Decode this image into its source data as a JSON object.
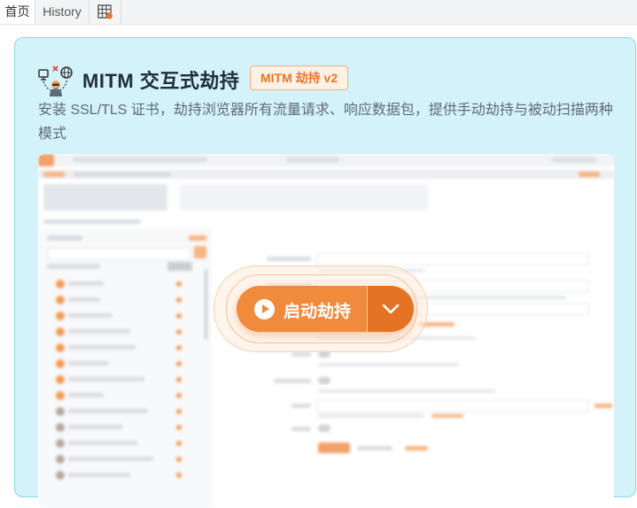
{
  "tabs": [
    {
      "label": "首页",
      "active": true
    },
    {
      "label": "History",
      "active": false
    },
    {
      "label": "",
      "icon": "table-icon"
    }
  ],
  "card": {
    "icon": "mitm-network-icon",
    "title": "MITM 交互式劫持",
    "badge": "MITM 劫持 v2",
    "description": "安装 SSL/TLS 证书，劫持浏览器所有流量请求、响应数据包，提供手动劫持与被动扫描两种模式",
    "start_button": "启动劫持",
    "dropdown_icon": "chevron-down-icon"
  },
  "colors": {
    "accent": "#f08a3c",
    "accent_dark": "#e47323",
    "card_bg": "#d4f2f9",
    "card_border": "#7fd9ea"
  }
}
